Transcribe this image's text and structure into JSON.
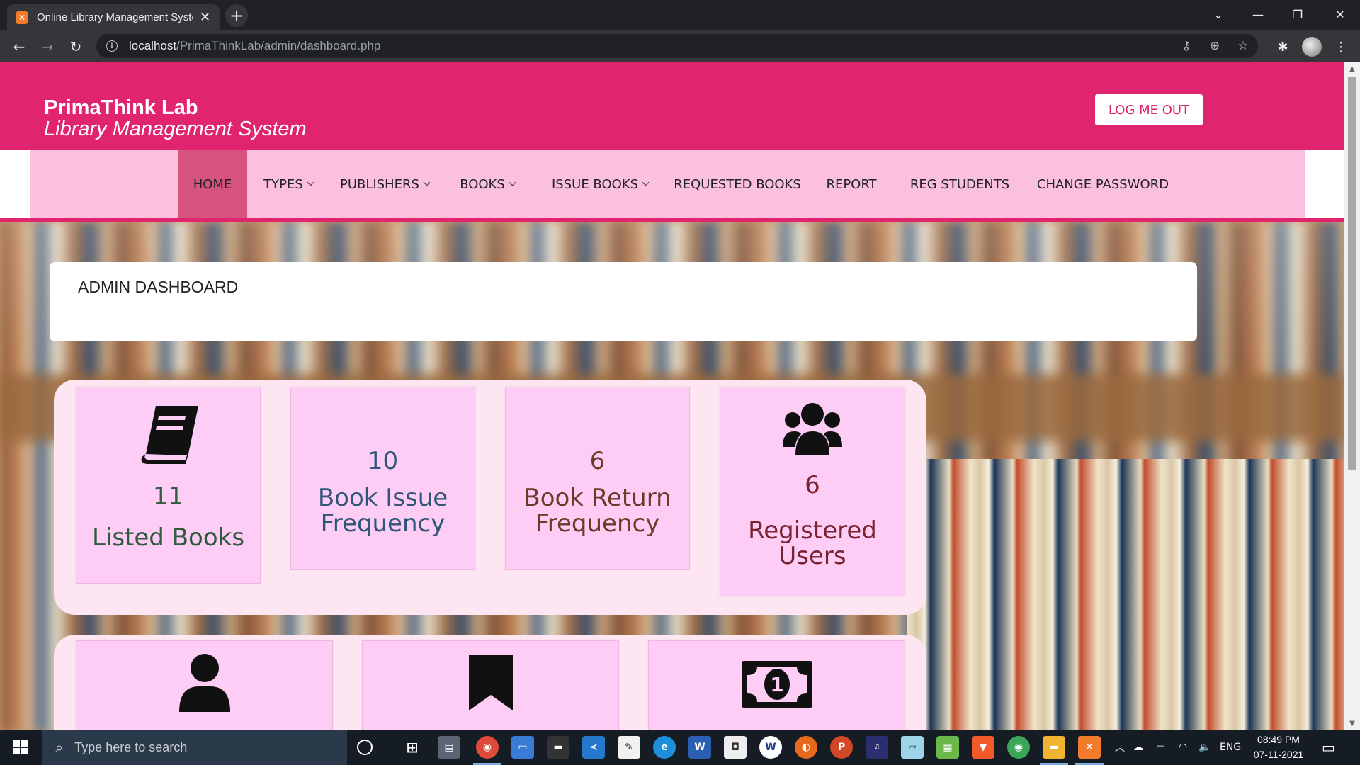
{
  "browser": {
    "tab_title": "Online Library Management System",
    "url_host": "localhost",
    "url_path": "/PrimaThinkLab/admin/dashboard.php"
  },
  "header": {
    "brand_line1": "PrimaThink Lab",
    "brand_line2": "Library Management System",
    "logout_label": "LOG ME OUT"
  },
  "nav": {
    "items": [
      {
        "label": "HOME",
        "active": true,
        "dropdown": false
      },
      {
        "label": "TYPES",
        "dropdown": true
      },
      {
        "label": "PUBLISHERS",
        "dropdown": true
      },
      {
        "label": "BOOKS",
        "dropdown": true
      },
      {
        "label": "ISSUE BOOKS",
        "dropdown": true
      },
      {
        "label": "REQUESTED BOOKS",
        "dropdown": false
      },
      {
        "label": "REPORT",
        "dropdown": false
      },
      {
        "label": "REG STUDENTS",
        "dropdown": false
      },
      {
        "label": "CHANGE PASSWORD",
        "dropdown": false
      }
    ]
  },
  "dashboard": {
    "title": "ADMIN DASHBOARD",
    "stats": [
      {
        "value": "11",
        "label": "Listed Books",
        "icon": "book-icon"
      },
      {
        "value": "10",
        "label_1": "Book Issue",
        "label_2": "Frequency"
      },
      {
        "value": "6",
        "label_1": "Book Return",
        "label_2": "Frequency"
      },
      {
        "value": "6",
        "label_1": "Registered",
        "label_2": "Users",
        "icon": "users-icon"
      }
    ],
    "row2_icons": [
      "user-icon",
      "bookmark-icon",
      "money-bill-icon"
    ],
    "colors": {
      "accent": "#e0246d",
      "nav_bg": "#fbbfdf",
      "card_bg": "#fdcdf5",
      "panel_bg": "#fde6f1"
    }
  },
  "taskbar": {
    "search_placeholder": "Type here to search",
    "language": "ENG",
    "time": "08:49 PM",
    "date": "07-11-2021"
  }
}
